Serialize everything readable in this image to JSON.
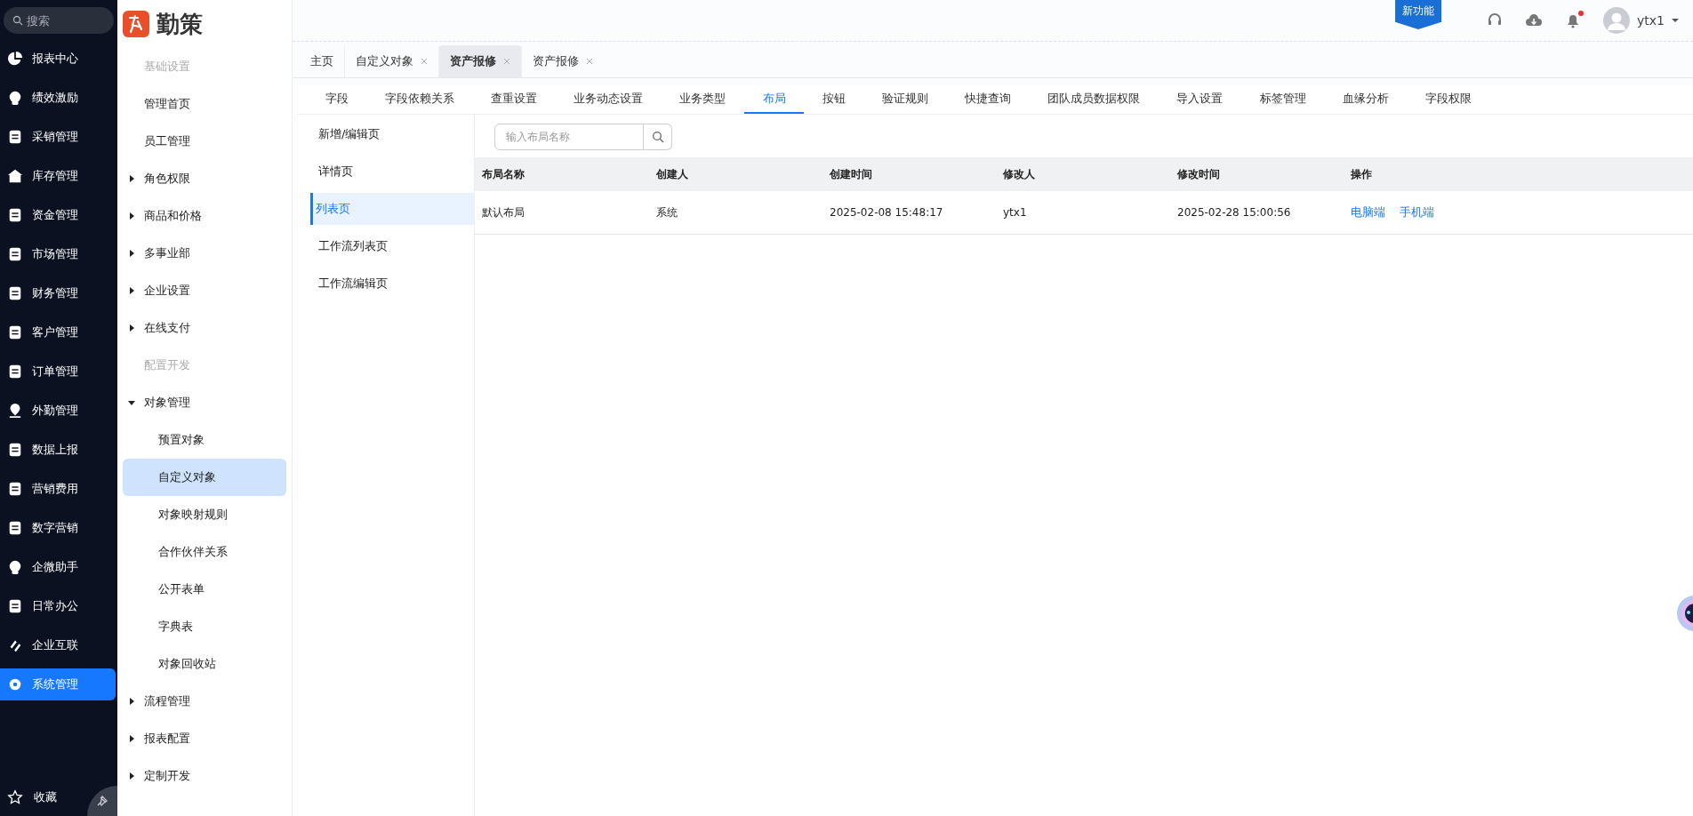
{
  "search": {
    "placeholder": "搜索"
  },
  "nav": [
    {
      "label": "报表中心",
      "selected": false
    },
    {
      "label": "绩效激励",
      "selected": false
    },
    {
      "label": "采销管理",
      "selected": false
    },
    {
      "label": "库存管理",
      "selected": false
    },
    {
      "label": "资金管理",
      "selected": false
    },
    {
      "label": "市场管理",
      "selected": false
    },
    {
      "label": "财务管理",
      "selected": false
    },
    {
      "label": "客户管理",
      "selected": false
    },
    {
      "label": "订单管理",
      "selected": false
    },
    {
      "label": "外勤管理",
      "selected": false
    },
    {
      "label": "数据上报",
      "selected": false
    },
    {
      "label": "营销费用",
      "selected": false
    },
    {
      "label": "数字营销",
      "selected": false
    },
    {
      "label": "企微助手",
      "selected": false
    },
    {
      "label": "日常办公",
      "selected": false
    },
    {
      "label": "企业互联",
      "selected": false
    },
    {
      "label": "系统管理",
      "selected": true
    }
  ],
  "favorites": {
    "label": "收藏"
  },
  "brand": {
    "name": "勤策"
  },
  "menu": [
    {
      "kind": "section",
      "label": "基础设置"
    },
    {
      "kind": "item",
      "label": "管理首页"
    },
    {
      "kind": "item",
      "label": "员工管理"
    },
    {
      "kind": "group",
      "label": "角色权限",
      "expanded": false
    },
    {
      "kind": "group",
      "label": "商品和价格",
      "expanded": false
    },
    {
      "kind": "group",
      "label": "多事业部",
      "expanded": false
    },
    {
      "kind": "group",
      "label": "企业设置",
      "expanded": false
    },
    {
      "kind": "group",
      "label": "在线支付",
      "expanded": false
    },
    {
      "kind": "section",
      "label": "配置开发"
    },
    {
      "kind": "group",
      "label": "对象管理",
      "expanded": true,
      "children": [
        {
          "label": "预置对象",
          "selected": false
        },
        {
          "label": "自定义对象",
          "selected": true
        },
        {
          "label": "对象映射规则",
          "selected": false
        },
        {
          "label": "合作伙伴关系",
          "selected": false
        },
        {
          "label": "公开表单",
          "selected": false
        },
        {
          "label": "字典表",
          "selected": false
        },
        {
          "label": "对象回收站",
          "selected": false
        }
      ]
    },
    {
      "kind": "group",
      "label": "流程管理",
      "expanded": false
    },
    {
      "kind": "group",
      "label": "报表配置",
      "expanded": false
    },
    {
      "kind": "group",
      "label": "定制开发",
      "expanded": false
    }
  ],
  "header": {
    "badge": "新功能",
    "notification": true,
    "user": "ytx1"
  },
  "tabs": [
    {
      "label": "主页",
      "selected": false,
      "closable": false
    },
    {
      "label": "自定义对象",
      "selected": false,
      "closable": true
    },
    {
      "label": "资产报修",
      "selected": true,
      "closable": true
    },
    {
      "label": "资产报修",
      "selected": false,
      "closable": true
    }
  ],
  "subtabs": [
    {
      "label": "字段",
      "selected": false
    },
    {
      "label": "字段依赖关系",
      "selected": false
    },
    {
      "label": "查重设置",
      "selected": false
    },
    {
      "label": "业务动态设置",
      "selected": false
    },
    {
      "label": "业务类型",
      "selected": false
    },
    {
      "label": "布局",
      "selected": true
    },
    {
      "label": "按钮",
      "selected": false
    },
    {
      "label": "验证规则",
      "selected": false
    },
    {
      "label": "快捷查询",
      "selected": false
    },
    {
      "label": "团队成员数据权限",
      "selected": false
    },
    {
      "label": "导入设置",
      "selected": false
    },
    {
      "label": "标签管理",
      "selected": false
    },
    {
      "label": "血缘分析",
      "selected": false
    },
    {
      "label": "字段权限",
      "selected": false
    }
  ],
  "pages": [
    {
      "label": "新增/编辑页",
      "selected": false
    },
    {
      "label": "详情页",
      "selected": false
    },
    {
      "label": "列表页",
      "selected": true
    },
    {
      "label": "工作流列表页",
      "selected": false
    },
    {
      "label": "工作流编辑页",
      "selected": false
    }
  ],
  "layout_search": {
    "placeholder": "输入布局名称"
  },
  "table": {
    "columns": [
      "布局名称",
      "创建人",
      "创建时间",
      "修改人",
      "修改时间",
      "操作"
    ],
    "rows": [
      {
        "cells": [
          "默认布局",
          "系统",
          "2025-02-08 15:48:17",
          "ytx1",
          "2025-02-28 15:00:56"
        ],
        "actions": [
          "电脑端",
          "手机端"
        ]
      }
    ]
  }
}
